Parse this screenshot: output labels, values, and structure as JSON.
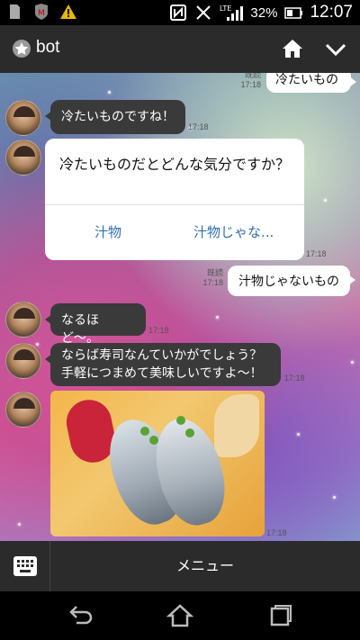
{
  "statusbar": {
    "battery_percent": "32%",
    "time": "12:07",
    "network": "LTE",
    "icons": [
      "sd-card-icon",
      "mcafee-icon",
      "warning-icon",
      "nfc-icon",
      "vibrate-off-icon",
      "signal-icon",
      "battery-icon"
    ]
  },
  "header": {
    "title": "bot",
    "icons": [
      "bot-badge-icon",
      "home-icon",
      "chevron-down-icon"
    ]
  },
  "chat": {
    "messages": [
      {
        "side": "right",
        "text": "冷たいもの",
        "read": "既読",
        "time": "17:18"
      },
      {
        "side": "left",
        "text": "冷たいものですね！",
        "time": "17:18"
      },
      {
        "side": "left",
        "type": "card",
        "question": "冷たいものだとどんな気分ですか？",
        "options": [
          "汁物",
          "汁物じゃな..."
        ],
        "time": "17:18"
      },
      {
        "side": "right",
        "text": "汁物じゃないもの",
        "read": "既読",
        "time": "17:18"
      },
      {
        "side": "left",
        "text": "なるほど〜。",
        "time": "17:18"
      },
      {
        "side": "left",
        "text": "ならば寿司なんていかがでしょう？\n手軽につまめて美味しいですよ〜！",
        "time": "17:18"
      },
      {
        "side": "left",
        "type": "image",
        "alt": "sushi",
        "time": "17:18"
      }
    ]
  },
  "menubar": {
    "menu_label": "メニュー"
  },
  "colors": {
    "header_bg": "#2b2b2b",
    "bubble_dark": "#3a3a3a",
    "link_blue": "#2d6fb0"
  }
}
